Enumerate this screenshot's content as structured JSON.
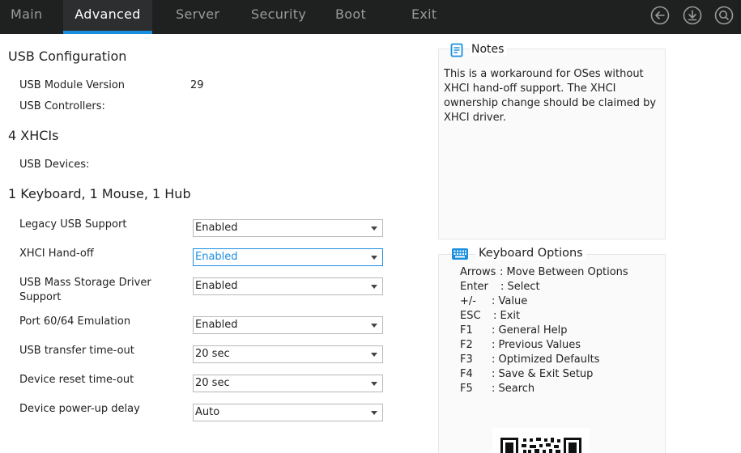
{
  "nav": {
    "tabs": [
      {
        "label": "Main"
      },
      {
        "label": "Advanced"
      },
      {
        "label": "Server"
      },
      {
        "label": "Security"
      },
      {
        "label": "Boot"
      },
      {
        "label": "Exit"
      }
    ],
    "active_tab": "Advanced",
    "accent_color": "#1a8fe0",
    "icons": [
      "back-icon",
      "save-download-icon",
      "search-icon"
    ]
  },
  "usb": {
    "title": "USB Configuration",
    "module_version_label": "USB Module Version",
    "module_version_value": "29",
    "controllers_label": "USB Controllers:",
    "controllers_value": "4 XHCIs",
    "devices_label": "USB Devices:",
    "devices_value": "1 Keyboard, 1 Mouse, 1 Hub"
  },
  "settings": [
    {
      "label": "Legacy USB Support",
      "value": "Enabled"
    },
    {
      "label": "XHCI Hand-off",
      "value": "Enabled"
    },
    {
      "label_line1": "USB Mass Storage Driver",
      "label_line2": "Support",
      "value": "Enabled"
    },
    {
      "label": "Port 60/64 Emulation",
      "value": "Enabled"
    },
    {
      "label": "USB transfer time-out",
      "value": "20 sec"
    },
    {
      "label": "Device reset time-out",
      "value": "20 sec"
    },
    {
      "label": "Device power-up delay",
      "value": "Auto"
    }
  ],
  "notes": {
    "title": "Notes",
    "lines": [
      "This is a workaround for OSes without",
      "XHCI hand-off support. The XHCI",
      "ownership change should be claimed by",
      "XHCI driver."
    ]
  },
  "keyboard": {
    "title": "Keyboard Options",
    "items": [
      {
        "key": "Arrows",
        "desc": ": Move Between Options"
      },
      {
        "key": "Enter",
        "desc": ": Select"
      },
      {
        "key": "+/-",
        "desc": ": Value"
      },
      {
        "key": "ESC",
        "desc": ": Exit"
      },
      {
        "key": "F1",
        "desc": ": General Help"
      },
      {
        "key": "F2",
        "desc": ": Previous Values"
      },
      {
        "key": "F3",
        "desc": ": Optimized Defaults"
      },
      {
        "key": "F4",
        "desc": ": Save & Exit Setup"
      },
      {
        "key": "F5",
        "desc": ": Search"
      }
    ]
  }
}
